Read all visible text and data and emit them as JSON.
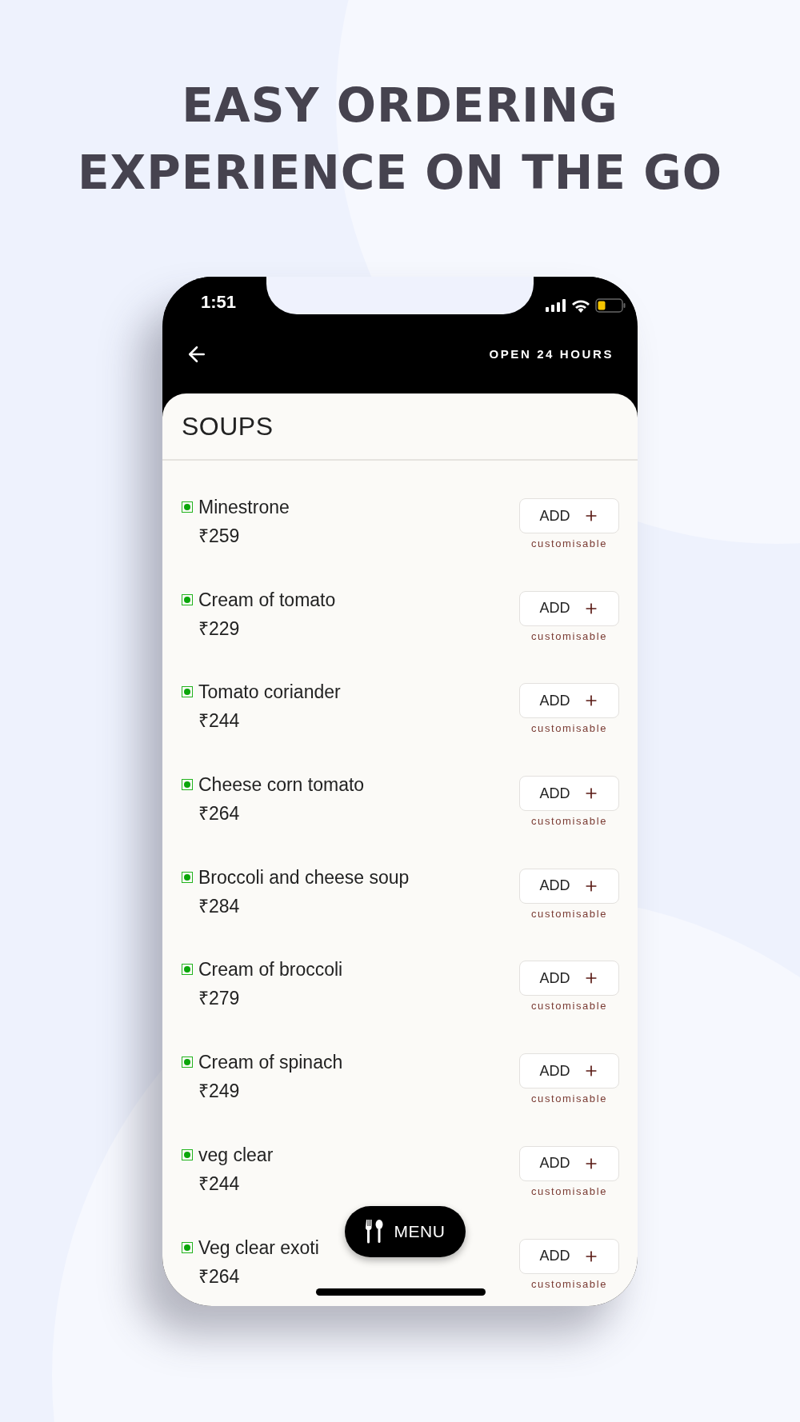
{
  "headline": [
    "EASY ORDERING",
    "EXPERIENCE ON THE GO"
  ],
  "status_bar": {
    "time": "1:51"
  },
  "header": {
    "info": "OPEN 24 HOURS"
  },
  "section": {
    "title": "SOUPS"
  },
  "items": [
    {
      "name": "Minestrone",
      "price": "₹259",
      "veg": true,
      "button": "ADD",
      "note": "customisable"
    },
    {
      "name": "Cream of tomato",
      "price": "₹229",
      "veg": true,
      "button": "ADD",
      "note": "customisable"
    },
    {
      "name": "Tomato coriander",
      "price": "₹244",
      "veg": true,
      "button": "ADD",
      "note": "customisable"
    },
    {
      "name": "Cheese corn tomato",
      "price": "₹264",
      "veg": true,
      "button": "ADD",
      "note": "customisable"
    },
    {
      "name": "Broccoli and cheese soup",
      "price": "₹284",
      "veg": true,
      "button": "ADD",
      "note": "customisable"
    },
    {
      "name": "Cream of broccoli",
      "price": "₹279",
      "veg": true,
      "button": "ADD",
      "note": "customisable"
    },
    {
      "name": "Cream of spinach",
      "price": "₹249",
      "veg": true,
      "button": "ADD",
      "note": "customisable"
    },
    {
      "name": "veg clear",
      "price": "₹244",
      "veg": true,
      "button": "ADD",
      "note": "customisable"
    },
    {
      "name": "Veg clear exoti",
      "price": "₹264",
      "veg": true,
      "button": "ADD",
      "note": "customisable"
    }
  ],
  "menu_button": {
    "label": "MENU"
  }
}
